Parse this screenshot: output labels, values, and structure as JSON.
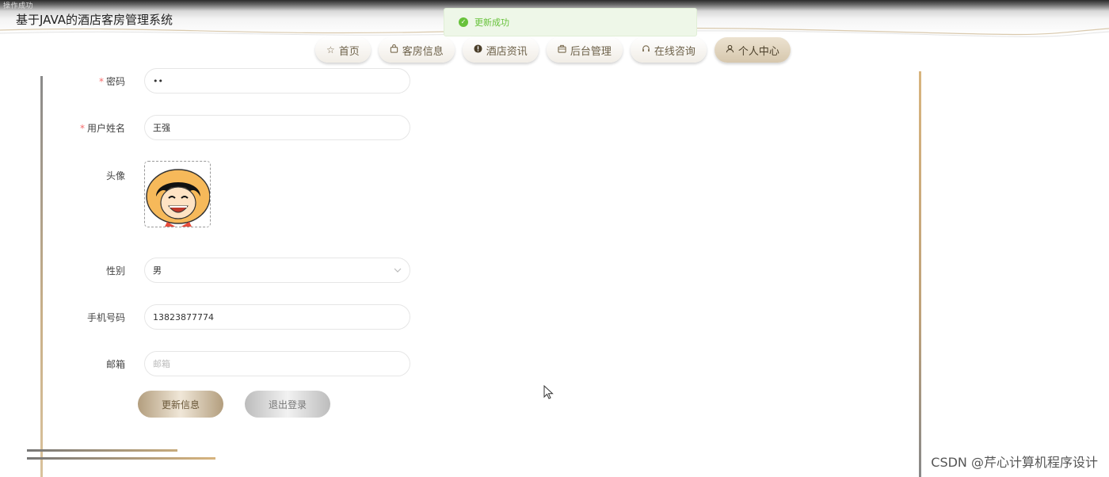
{
  "header": {
    "breadcrumb": "操作成功",
    "site_title": "基于JAVA的酒店客房管理系统"
  },
  "toast": {
    "message": "更新成功",
    "icon": "check-circle-icon",
    "color": "#67c23a"
  },
  "nav": {
    "tabs": [
      {
        "label": "首页",
        "icon": "star-icon"
      },
      {
        "label": "客房信息",
        "icon": "bag-icon"
      },
      {
        "label": "酒店资讯",
        "icon": "info-icon"
      },
      {
        "label": "后台管理",
        "icon": "briefcase-icon"
      },
      {
        "label": "在线咨询",
        "icon": "headset-icon"
      },
      {
        "label": "个人中心",
        "icon": "user-icon",
        "active": true
      }
    ]
  },
  "form": {
    "password": {
      "label": "密码",
      "value": "••",
      "required": true
    },
    "name": {
      "label": "用户姓名",
      "value": "王强",
      "required": true
    },
    "avatar": {
      "label": "头像"
    },
    "gender": {
      "label": "性别",
      "value": "男"
    },
    "phone": {
      "label": "手机号码",
      "value": "13823877774"
    },
    "email": {
      "label": "邮箱",
      "value": "",
      "placeholder": "邮箱"
    }
  },
  "buttons": {
    "update": "更新信息",
    "logout": "退出登录"
  },
  "watermark": "CSDN @芹心计算机程序设计",
  "colors": {
    "accent": "#d6c7ad",
    "required": "#f56c6c"
  }
}
